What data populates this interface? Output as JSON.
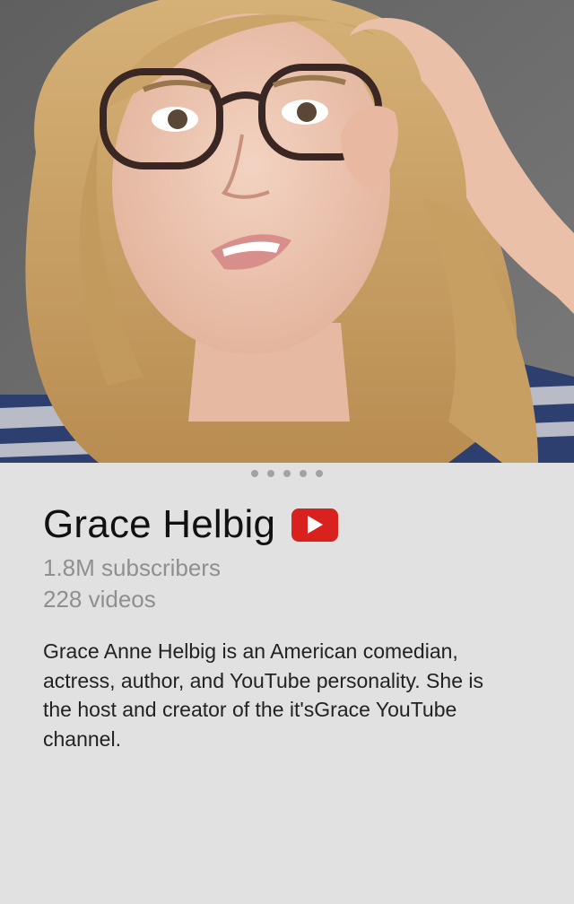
{
  "channel": {
    "name": "Grace Helbig",
    "subscribers": "1.8M subscribers",
    "videos": "228 videos",
    "description": "Grace Anne Helbig is an American comedian, actress, author, and YouTube personality. She is the host and creator of the it'sGrace YouTube channel.",
    "badge_icon": "youtube-play-icon"
  },
  "pager": {
    "count": 5,
    "active_index": 0
  },
  "colors": {
    "background": "#e1e1e1",
    "youtube_red": "#d9211d",
    "muted_text": "#8f8f8f"
  }
}
